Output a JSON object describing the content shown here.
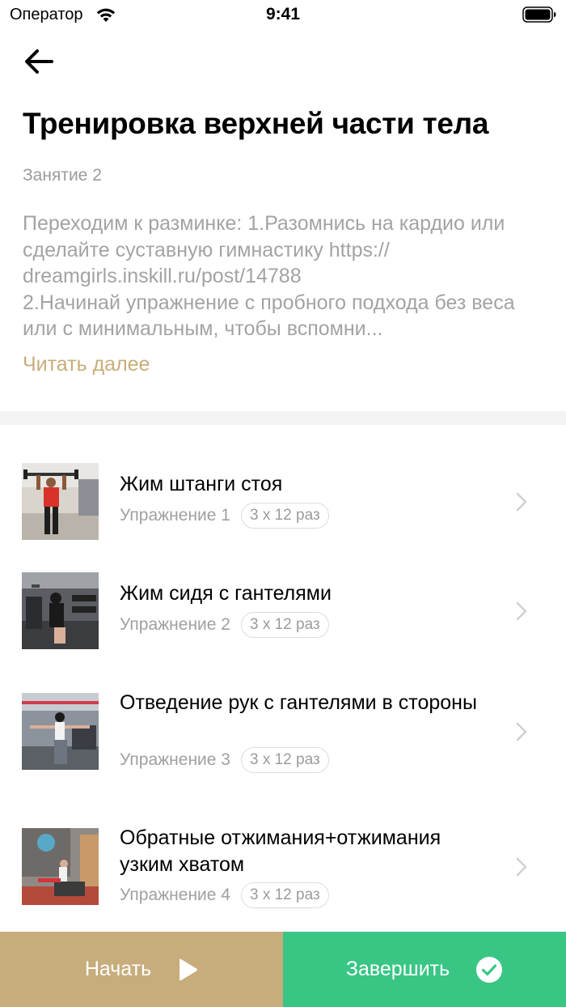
{
  "status_bar": {
    "carrier": "Оператор",
    "time": "9:41"
  },
  "header": {
    "back_icon": "arrow-left-icon",
    "title": "Тренировка верхней части тела",
    "lesson": "Занятие 2",
    "description": "Переходим к разминке: 1.Разомнись на кардио или сделайте суставную гимнастику https:// dreamgirls.inskill.ru/post/14788\n2.Начинай упражнение с пробного подхода без веса или с минимальным, чтобы вспомни...",
    "read_more": "Читать далее"
  },
  "exercises": [
    {
      "name": "Жим штанги стоя",
      "label": "Упражнение 1",
      "sets": "3 х 12 раз"
    },
    {
      "name": "Жим сидя с гантелями",
      "label": "Упражнение 2",
      "sets": "3 х 12 раз"
    },
    {
      "name": "Отведение рук с гантелями в стороны",
      "label": "Упражнение 3",
      "sets": "3 х 12 раз"
    },
    {
      "name": "Обратные отжимания+отжимания узким хватом",
      "label": "Упражнение 4",
      "sets": "3 х 12 раз"
    }
  ],
  "bottom_bar": {
    "start_label": "Начать",
    "start_icon": "play-icon",
    "finish_label": "Завершить",
    "finish_icon": "check-circle-icon"
  },
  "colors": {
    "accent_gold": "#c9ad78",
    "start_button": "#c7ad7c",
    "finish_button": "#39c685",
    "muted_text": "#a3a3a3"
  }
}
